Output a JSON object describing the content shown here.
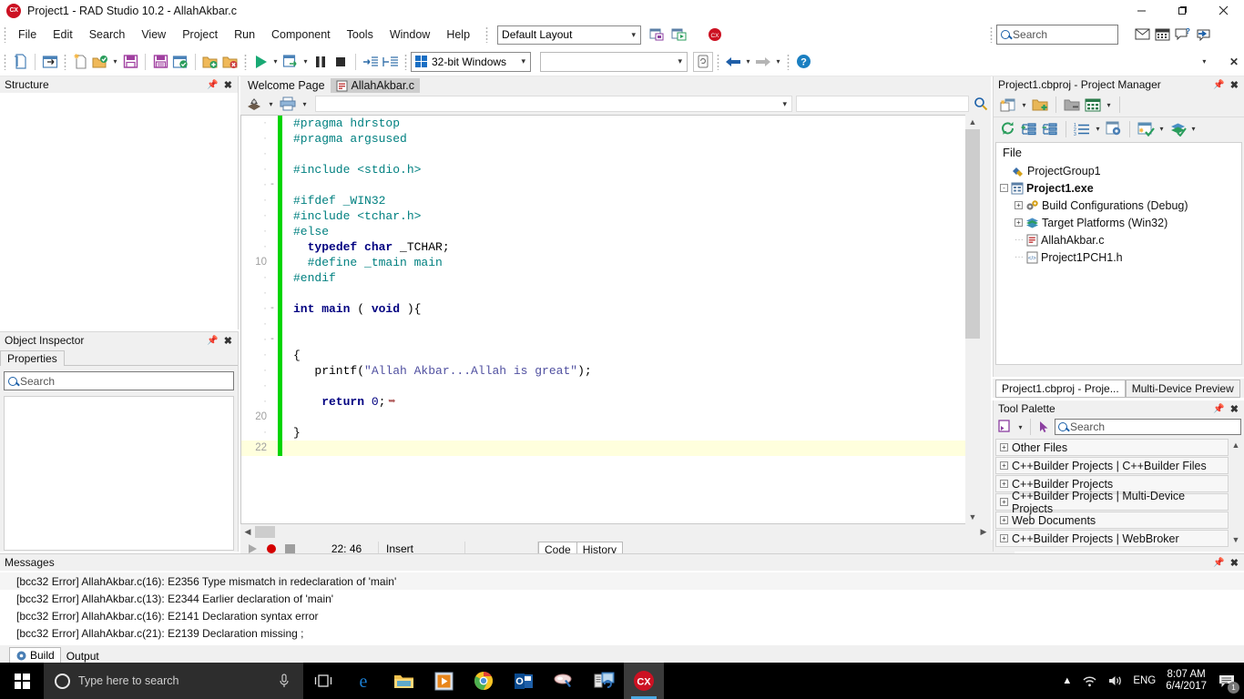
{
  "window": {
    "title": "Project1 - RAD Studio 10.2 - AllahAkbar.c",
    "logo_text": "CX",
    "minimize": "—",
    "maximize": "❐",
    "close": "✕"
  },
  "menu": {
    "items": [
      "File",
      "Edit",
      "Search",
      "View",
      "Project",
      "Run",
      "Component",
      "Tools",
      "Window",
      "Help"
    ],
    "layout_value": "Default Layout",
    "search_placeholder": "Search"
  },
  "toolbar": {
    "platform_value": "32-bit Windows",
    "target_value": ""
  },
  "structure": {
    "title": "Structure"
  },
  "object_inspector": {
    "title": "Object Inspector",
    "tab": "Properties",
    "search_placeholder": "Search"
  },
  "editor": {
    "tabs": [
      {
        "label": "Welcome Page",
        "active": false
      },
      {
        "label": "AllahAkbar.c",
        "active": true
      }
    ],
    "lines": [
      {
        "num": "",
        "text": "#pragma hdrstop",
        "cls": "pp",
        "fold": ""
      },
      {
        "num": "",
        "text": "#pragma argsused",
        "cls": "pp",
        "fold": ""
      },
      {
        "num": "",
        "text": "",
        "cls": "plain",
        "fold": ""
      },
      {
        "num": "",
        "text": "#include <stdio.h>",
        "cls": "pp",
        "fold": ""
      },
      {
        "num": "",
        "text": "",
        "cls": "plain",
        "fold": "-"
      },
      {
        "num": "",
        "text": "#ifdef _WIN32",
        "cls": "pp",
        "fold": ""
      },
      {
        "num": "",
        "text": "#include <tchar.h>",
        "cls": "pp",
        "fold": ""
      },
      {
        "num": "",
        "text": "#else",
        "cls": "pp",
        "fold": ""
      },
      {
        "num": "",
        "text": "  typedef char _TCHAR;",
        "cls": "kw",
        "fold": ""
      },
      {
        "num": "10",
        "text": "  #define _tmain main",
        "cls": "pp",
        "fold": ""
      },
      {
        "num": "",
        "text": "#endif",
        "cls": "pp",
        "fold": ""
      },
      {
        "num": "",
        "text": "",
        "cls": "plain",
        "fold": ""
      },
      {
        "num": "",
        "text": "int main ( void ){",
        "cls": "kw",
        "fold": "-"
      },
      {
        "num": "",
        "text": "",
        "cls": "plain",
        "fold": ""
      },
      {
        "num": "",
        "text": "",
        "cls": "plain",
        "fold": "-"
      },
      {
        "num": "",
        "text": "{",
        "cls": "plain",
        "fold": ""
      },
      {
        "num": "",
        "text": "   printf(\"Allah Akbar...Allah is great\");",
        "cls": "mixed",
        "fold": ""
      },
      {
        "num": "",
        "text": "",
        "cls": "plain",
        "fold": ""
      },
      {
        "num": "",
        "text": "    return 0;",
        "cls": "kw",
        "fold": ""
      },
      {
        "num": "20",
        "text": "",
        "cls": "plain",
        "fold": ""
      },
      {
        "num": "",
        "text": "}",
        "cls": "plain",
        "fold": ""
      },
      {
        "num": "22",
        "text": "",
        "cls": "plain",
        "fold": "",
        "current": true
      }
    ],
    "code_literal": {
      "printf_call": "   printf(",
      "printf_string": "\"Allah Akbar...Allah is great\"",
      "printf_end": ");",
      "return_kw": "    return ",
      "return_val": "0",
      "return_end": ";"
    },
    "status": {
      "caret": "22: 46",
      "mode": "Insert",
      "tabs": [
        "Code",
        "History"
      ]
    }
  },
  "project_manager": {
    "title": "Project1.cbproj - Project Manager",
    "column_header": "File",
    "tree": [
      {
        "label": "ProjectGroup1",
        "indent": 0,
        "expander": "",
        "bold": false,
        "icon": "project-group-icon"
      },
      {
        "label": "Project1.exe",
        "indent": 0,
        "expander": "-",
        "bold": true,
        "icon": "exe-icon"
      },
      {
        "label": "Build Configurations (Debug)",
        "indent": 1,
        "expander": "+",
        "bold": false,
        "icon": "gears-icon"
      },
      {
        "label": "Target Platforms (Win32)",
        "indent": 1,
        "expander": "+",
        "bold": false,
        "icon": "layers-icon"
      },
      {
        "label": "AllahAkbar.c",
        "indent": 1,
        "expander": "",
        "bold": false,
        "icon": "c-file-icon"
      },
      {
        "label": "Project1PCH1.h",
        "indent": 1,
        "expander": "",
        "bold": false,
        "icon": "h-file-icon"
      }
    ],
    "tabs": [
      {
        "label": "Project1.cbproj - Proje...",
        "active": true
      },
      {
        "label": "Multi-Device Preview",
        "active": false
      }
    ]
  },
  "tool_palette": {
    "title": "Tool Palette",
    "search_placeholder": "Search",
    "rows": [
      "Other Files",
      "C++Builder Projects | C++Builder Files",
      "C++Builder Projects",
      "C++Builder Projects | Multi-Device Projects",
      "Web Documents",
      "C++Builder Projects | WebBroker"
    ]
  },
  "messages": {
    "title": "Messages",
    "rows": [
      "[bcc32 Error] AllahAkbar.c(16): E2356 Type mismatch in redeclaration of 'main'",
      "[bcc32 Error] AllahAkbar.c(13): E2344 Earlier declaration of 'main'",
      "[bcc32 Error] AllahAkbar.c(16): E2141 Declaration syntax error",
      "[bcc32 Error] AllahAkbar.c(21): E2139 Declaration missing ;"
    ],
    "tabs": [
      "Build",
      "Output"
    ]
  },
  "taskbar": {
    "search_placeholder": "Type here to search",
    "language": "ENG",
    "time": "8:07 AM",
    "date": "6/4/2017",
    "notification_count": "1"
  },
  "colors": {
    "accent_green": "#00d400",
    "preproc": "#008080",
    "keyword": "#000080",
    "string": "#5050a0",
    "brand_red": "#cc1122",
    "taskbar": "#000000"
  }
}
